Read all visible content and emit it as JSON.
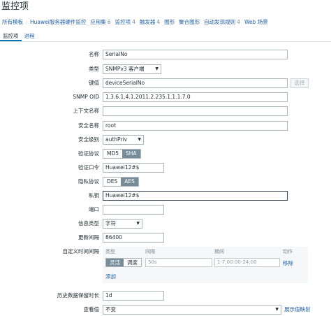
{
  "page": {
    "title": "监控项"
  },
  "nav": {
    "items": [
      {
        "label": "所有模板",
        "count": ""
      },
      {
        "label": "Huawei服务器硬件监控",
        "count": ""
      },
      {
        "label": "应用集",
        "count": "6"
      },
      {
        "label": "监控项",
        "count": "4"
      },
      {
        "label": "触发器",
        "count": "4"
      },
      {
        "label": "图形",
        "count": ""
      },
      {
        "label": "聚合图形",
        "count": ""
      },
      {
        "label": "自动发现规则",
        "count": "4"
      },
      {
        "label": "Web 场景",
        "count": ""
      }
    ]
  },
  "tabs": [
    {
      "label": "监控项",
      "active": true
    },
    {
      "label": "进程",
      "active": false
    }
  ],
  "form": {
    "name": {
      "label": "名称",
      "value": "SerialNo"
    },
    "type": {
      "label": "类型",
      "value": "SNMPv3 客户端"
    },
    "key": {
      "label": "键值",
      "value": "deviceSerialNo",
      "button": "选择"
    },
    "oid": {
      "label": "SNMP OID",
      "value": "1.3.6.1.4.1.2011.2.235.1.1.1.7.0"
    },
    "context": {
      "label": "上下文名称",
      "value": ""
    },
    "security_name": {
      "label": "安全名称",
      "value": "root"
    },
    "security_level": {
      "label": "安全级别",
      "value": "authPriv"
    },
    "auth_protocol": {
      "label": "验证协议",
      "options": [
        "MD5",
        "SHA"
      ],
      "selected": "SHA"
    },
    "auth_passphrase": {
      "label": "验证口令",
      "value": "Huawei12#$"
    },
    "priv_protocol": {
      "label": "隐私协议",
      "options": [
        "DES",
        "AES"
      ],
      "selected": "AES"
    },
    "priv_key": {
      "label": "私钥",
      "value": "Huawei12#$"
    },
    "port": {
      "label": "端口",
      "value": ""
    },
    "info_type": {
      "label": "信息类型",
      "value": "字符"
    },
    "update_interval": {
      "label": "更新间隔",
      "value": "86400"
    },
    "custom_intervals": {
      "label": "自定义时间间隔",
      "headers": {
        "type": "类型",
        "interval": "间隔",
        "period": "期间",
        "action": "动作"
      },
      "row": {
        "type_options": [
          "灵活",
          "调度"
        ],
        "type_selected": "灵活",
        "interval_placeholder": "50s",
        "period_placeholder": "1-7,00:00-24:00",
        "remove": "移除"
      },
      "add": "添加"
    },
    "history": {
      "label": "历史数据保留时长",
      "value": "1d"
    },
    "show_value": {
      "label": "查看值",
      "value": "不变",
      "link": "展示值映射"
    }
  }
}
